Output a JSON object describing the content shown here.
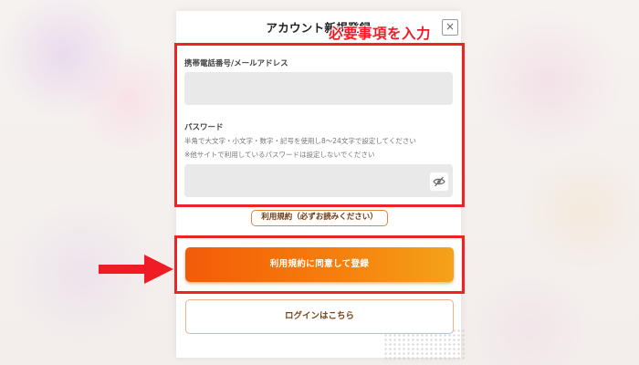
{
  "dialog": {
    "title": "アカウント新規登録",
    "close_label": "×"
  },
  "annotation": {
    "text": "必要事項を入力",
    "color": "#ee1c24"
  },
  "form": {
    "id_label": "携帯電話番号/メールアドレス",
    "id_value": "",
    "password_label": "パスワード",
    "password_hint_1": "半角で大文字・小文字・数字・記号を使用し8〜24文字で設定してください",
    "password_hint_2": "※他サイトで利用しているパスワードは設定しないでください",
    "password_value": "",
    "visibility_icon": "eye-off-icon"
  },
  "terms_link": "利用規約（必ずお読みください）",
  "register_button": "利用規約に同意して登録",
  "login_button": "ログインはこちら",
  "colors": {
    "accent_orange": "#f67e0c",
    "highlight_red": "#ee2229"
  }
}
